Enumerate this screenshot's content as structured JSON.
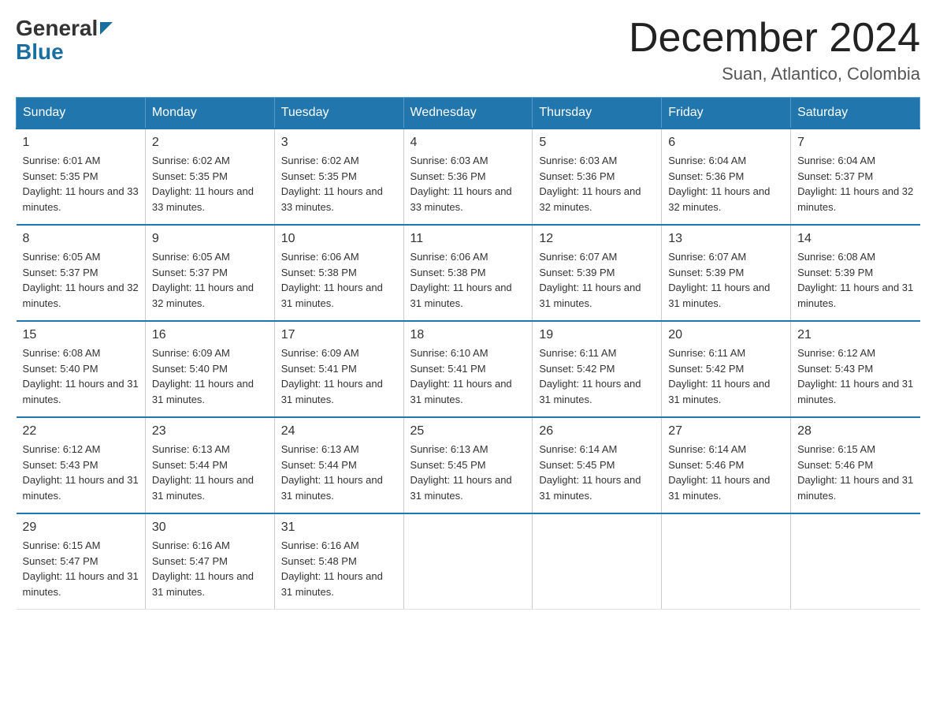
{
  "logo": {
    "general": "General",
    "arrow": "▶",
    "blue": "Blue"
  },
  "header": {
    "month": "December 2024",
    "location": "Suan, Atlantico, Colombia"
  },
  "weekdays": [
    "Sunday",
    "Monday",
    "Tuesday",
    "Wednesday",
    "Thursday",
    "Friday",
    "Saturday"
  ],
  "weeks": [
    [
      {
        "day": "1",
        "sunrise": "6:01 AM",
        "sunset": "5:35 PM",
        "daylight": "11 hours and 33 minutes."
      },
      {
        "day": "2",
        "sunrise": "6:02 AM",
        "sunset": "5:35 PM",
        "daylight": "11 hours and 33 minutes."
      },
      {
        "day": "3",
        "sunrise": "6:02 AM",
        "sunset": "5:35 PM",
        "daylight": "11 hours and 33 minutes."
      },
      {
        "day": "4",
        "sunrise": "6:03 AM",
        "sunset": "5:36 PM",
        "daylight": "11 hours and 33 minutes."
      },
      {
        "day": "5",
        "sunrise": "6:03 AM",
        "sunset": "5:36 PM",
        "daylight": "11 hours and 32 minutes."
      },
      {
        "day": "6",
        "sunrise": "6:04 AM",
        "sunset": "5:36 PM",
        "daylight": "11 hours and 32 minutes."
      },
      {
        "day": "7",
        "sunrise": "6:04 AM",
        "sunset": "5:37 PM",
        "daylight": "11 hours and 32 minutes."
      }
    ],
    [
      {
        "day": "8",
        "sunrise": "6:05 AM",
        "sunset": "5:37 PM",
        "daylight": "11 hours and 32 minutes."
      },
      {
        "day": "9",
        "sunrise": "6:05 AM",
        "sunset": "5:37 PM",
        "daylight": "11 hours and 32 minutes."
      },
      {
        "day": "10",
        "sunrise": "6:06 AM",
        "sunset": "5:38 PM",
        "daylight": "11 hours and 31 minutes."
      },
      {
        "day": "11",
        "sunrise": "6:06 AM",
        "sunset": "5:38 PM",
        "daylight": "11 hours and 31 minutes."
      },
      {
        "day": "12",
        "sunrise": "6:07 AM",
        "sunset": "5:39 PM",
        "daylight": "11 hours and 31 minutes."
      },
      {
        "day": "13",
        "sunrise": "6:07 AM",
        "sunset": "5:39 PM",
        "daylight": "11 hours and 31 minutes."
      },
      {
        "day": "14",
        "sunrise": "6:08 AM",
        "sunset": "5:39 PM",
        "daylight": "11 hours and 31 minutes."
      }
    ],
    [
      {
        "day": "15",
        "sunrise": "6:08 AM",
        "sunset": "5:40 PM",
        "daylight": "11 hours and 31 minutes."
      },
      {
        "day": "16",
        "sunrise": "6:09 AM",
        "sunset": "5:40 PM",
        "daylight": "11 hours and 31 minutes."
      },
      {
        "day": "17",
        "sunrise": "6:09 AM",
        "sunset": "5:41 PM",
        "daylight": "11 hours and 31 minutes."
      },
      {
        "day": "18",
        "sunrise": "6:10 AM",
        "sunset": "5:41 PM",
        "daylight": "11 hours and 31 minutes."
      },
      {
        "day": "19",
        "sunrise": "6:11 AM",
        "sunset": "5:42 PM",
        "daylight": "11 hours and 31 minutes."
      },
      {
        "day": "20",
        "sunrise": "6:11 AM",
        "sunset": "5:42 PM",
        "daylight": "11 hours and 31 minutes."
      },
      {
        "day": "21",
        "sunrise": "6:12 AM",
        "sunset": "5:43 PM",
        "daylight": "11 hours and 31 minutes."
      }
    ],
    [
      {
        "day": "22",
        "sunrise": "6:12 AM",
        "sunset": "5:43 PM",
        "daylight": "11 hours and 31 minutes."
      },
      {
        "day": "23",
        "sunrise": "6:13 AM",
        "sunset": "5:44 PM",
        "daylight": "11 hours and 31 minutes."
      },
      {
        "day": "24",
        "sunrise": "6:13 AM",
        "sunset": "5:44 PM",
        "daylight": "11 hours and 31 minutes."
      },
      {
        "day": "25",
        "sunrise": "6:13 AM",
        "sunset": "5:45 PM",
        "daylight": "11 hours and 31 minutes."
      },
      {
        "day": "26",
        "sunrise": "6:14 AM",
        "sunset": "5:45 PM",
        "daylight": "11 hours and 31 minutes."
      },
      {
        "day": "27",
        "sunrise": "6:14 AM",
        "sunset": "5:46 PM",
        "daylight": "11 hours and 31 minutes."
      },
      {
        "day": "28",
        "sunrise": "6:15 AM",
        "sunset": "5:46 PM",
        "daylight": "11 hours and 31 minutes."
      }
    ],
    [
      {
        "day": "29",
        "sunrise": "6:15 AM",
        "sunset": "5:47 PM",
        "daylight": "11 hours and 31 minutes."
      },
      {
        "day": "30",
        "sunrise": "6:16 AM",
        "sunset": "5:47 PM",
        "daylight": "11 hours and 31 minutes."
      },
      {
        "day": "31",
        "sunrise": "6:16 AM",
        "sunset": "5:48 PM",
        "daylight": "11 hours and 31 minutes."
      },
      null,
      null,
      null,
      null
    ]
  ]
}
